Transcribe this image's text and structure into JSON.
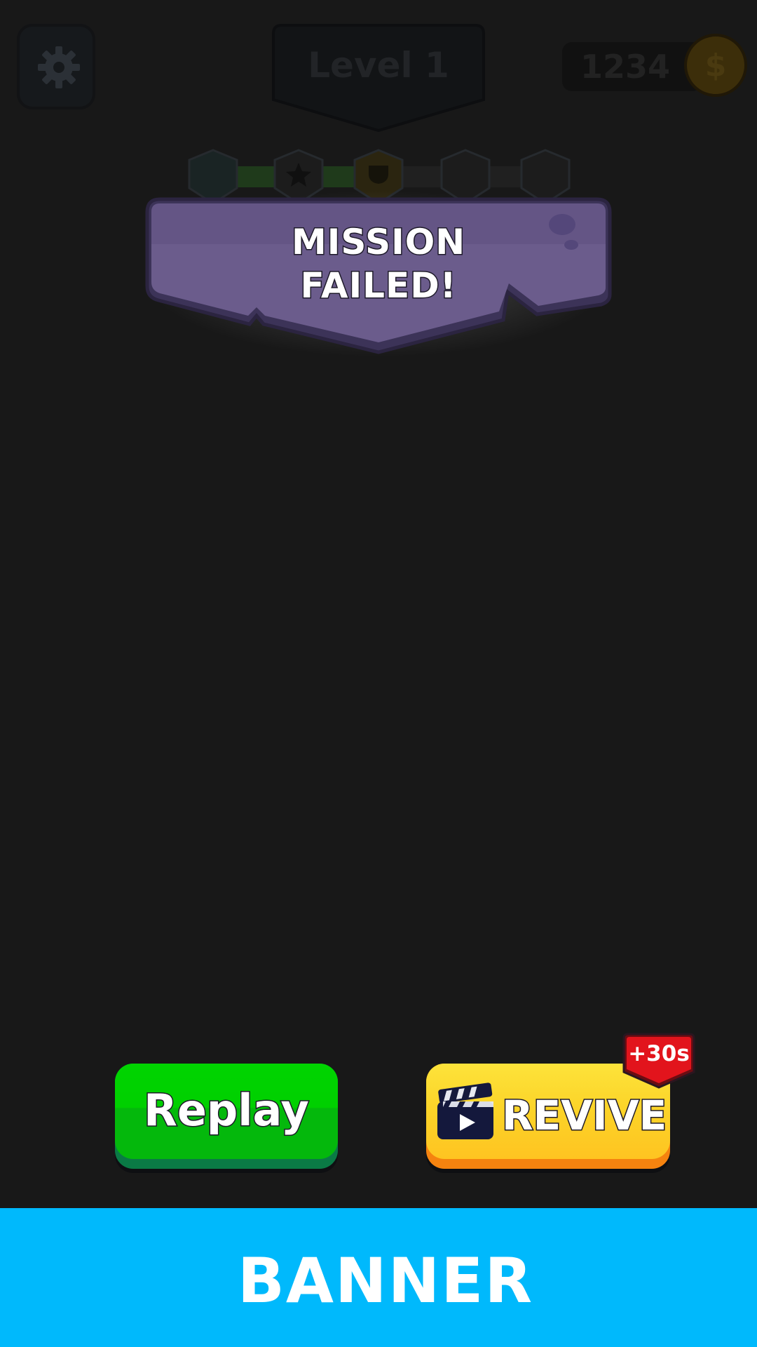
{
  "hud": {
    "settings_icon": "gear-icon",
    "level_label": "Level 1",
    "coins": "1234",
    "coin_icon_symbol": "$",
    "progress": 0.5,
    "milestone_icons": [
      "shield-icon",
      "star-icon",
      "trophy-icon",
      "shield-icon",
      "shield-icon"
    ]
  },
  "mission": {
    "line1": "MISSION",
    "line2": "FAILED!"
  },
  "buttons": {
    "replay_label": "Replay",
    "revive_label": "REVIVE",
    "revive_icon": "clapperboard-play-icon",
    "revive_bonus": "+30s"
  },
  "ad": {
    "label": "BANNER"
  },
  "colors": {
    "background": "#181818",
    "mission_banner": "#6b5c8c",
    "replay_green": "#00d000",
    "revive_yellow": "#fcd328",
    "badge_red": "#e2141c",
    "ad_banner": "#00b9fc"
  }
}
